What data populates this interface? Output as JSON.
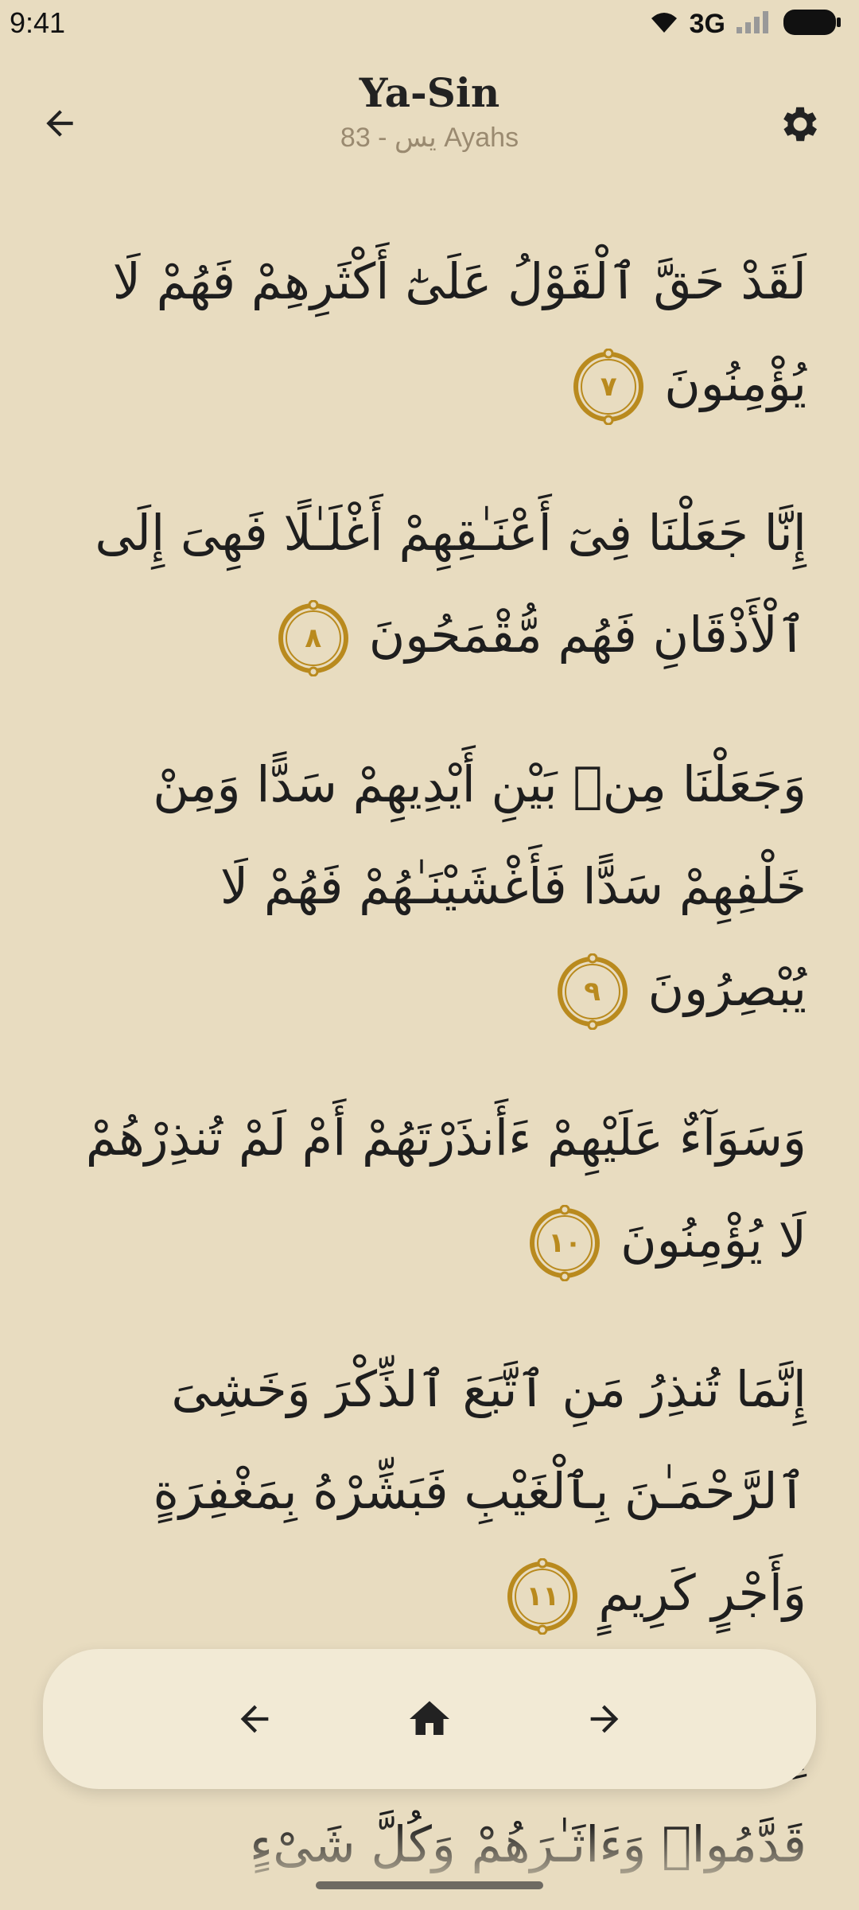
{
  "status_bar": {
    "time": "9:41",
    "network": "3G"
  },
  "header": {
    "title": "Ya-Sin",
    "subtitle": "يس - 83 Ayahs"
  },
  "ayahs": [
    {
      "text": "لَقَدْ حَقَّ ٱلْقَوْلُ عَلَىٰٓ أَكْثَرِهِمْ فَهُمْ لَا يُؤْمِنُونَ",
      "number": "٧"
    },
    {
      "text": "إِنَّا جَعَلْنَا فِىٓ أَعْنَـٰقِهِمْ أَغْلَـٰلًا فَهِىَ إِلَى ٱلْأَذْقَانِ فَهُم مُّقْمَحُونَ",
      "number": "٨"
    },
    {
      "text": "وَجَعَلْنَا مِنۢ بَيْنِ أَيْدِيهِمْ سَدًّا وَمِنْ خَلْفِهِمْ سَدًّا فَأَغْشَيْنَـٰهُمْ فَهُمْ لَا يُبْصِرُونَ",
      "number": "٩"
    },
    {
      "text": "وَسَوَآءٌ عَلَيْهِمْ ءَأَنذَرْتَهُمْ أَمْ لَمْ تُنذِرْهُمْ لَا يُؤْمِنُونَ",
      "number": "١٠"
    },
    {
      "text": "إِنَّمَا تُنذِرُ مَنِ ٱتَّبَعَ ٱلذِّكْرَ وَخَشِىَ ٱلرَّحْمَـٰنَ بِٱلْغَيْبِ فَبَشِّرْهُ بِمَغْفِرَةٍ وَأَجْرٍ كَرِيمٍ",
      "number": "١١"
    },
    {
      "text": "إِنَّا نَحْنُ نُحْىِ ٱلْمَوْتَىٰ وَنَكْتُبُ مَا قَدَّمُوا۟ وَءَاثَـٰرَهُمْ وَكُلَّ شَىْءٍ",
      "number": ""
    }
  ],
  "icons": {
    "back": "arrow-left-icon",
    "settings": "gear-icon",
    "nav_prev": "arrow-left-icon",
    "nav_home": "home-icon",
    "nav_next": "arrow-right-icon"
  },
  "colors": {
    "background": "#E8DCC0",
    "nav_background": "#F2EAD5",
    "accent_gold": "#B98A1E",
    "text": "#1E1E1E",
    "subtitle": "#9A8A70"
  }
}
